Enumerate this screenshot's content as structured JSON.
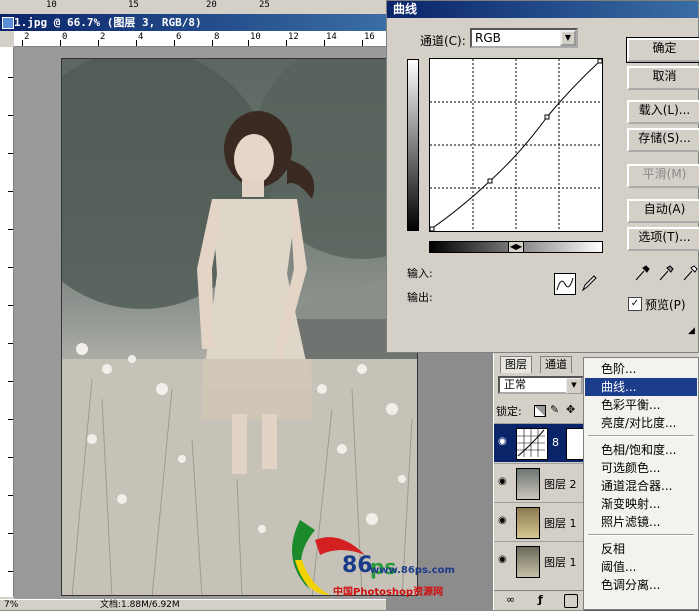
{
  "document": {
    "title": "1.jpg @ 66.7% (图层 3, RGB/8)",
    "top_ticks": [
      "10",
      "15",
      "20",
      "25"
    ],
    "ruler_labels": [
      "2",
      "0",
      "2",
      "4",
      "6",
      "8",
      "10",
      "12",
      "14",
      "16"
    ],
    "status_zoom": "7%",
    "status_doc": "文档:1.88M/6.92M"
  },
  "curves_dialog": {
    "title": "曲线",
    "channel_label": "通道(C):",
    "channel_value": "RGB",
    "input_label": "输入:",
    "output_label": "输出:",
    "buttons": {
      "ok": "确定",
      "cancel": "取消",
      "load": "载入(L)...",
      "save": "存储(S)...",
      "smooth": "平滑(M)",
      "auto": "自动(A)",
      "options": "选项(T)..."
    },
    "preview_label": "预览(P)",
    "preview_checked": "✓"
  },
  "layers_panel": {
    "tabs": [
      "图层",
      "通道"
    ],
    "blend_mode": "正常",
    "lock_label": "锁定:",
    "layers": [
      {
        "name": "",
        "type": "curves-adjustment"
      },
      {
        "name": "图层 2"
      },
      {
        "name": "图层 1"
      },
      {
        "name": "图层 1"
      }
    ]
  },
  "adjustment_menu": {
    "items": [
      {
        "label": "色阶..."
      },
      {
        "label": "曲线...",
        "highlighted": true
      },
      {
        "label": "色彩平衡..."
      },
      {
        "label": "亮度/对比度..."
      },
      {
        "separator": true
      },
      {
        "label": "色相/饱和度..."
      },
      {
        "label": "可选颜色..."
      },
      {
        "label": "通道混合器..."
      },
      {
        "label": "渐变映射..."
      },
      {
        "label": "照片滤镜..."
      },
      {
        "separator": true
      },
      {
        "label": "反相"
      },
      {
        "label": "阈值..."
      },
      {
        "label": "色调分离..."
      }
    ]
  },
  "watermark": {
    "url": "www.86ps.com",
    "text": "中国Photoshop资源网",
    "logo": "86ps"
  },
  "colors": {
    "title_bar": "#0a246a",
    "menu_highlight": "#1c3c8c",
    "dialog_bg": "#d4d0c8"
  }
}
